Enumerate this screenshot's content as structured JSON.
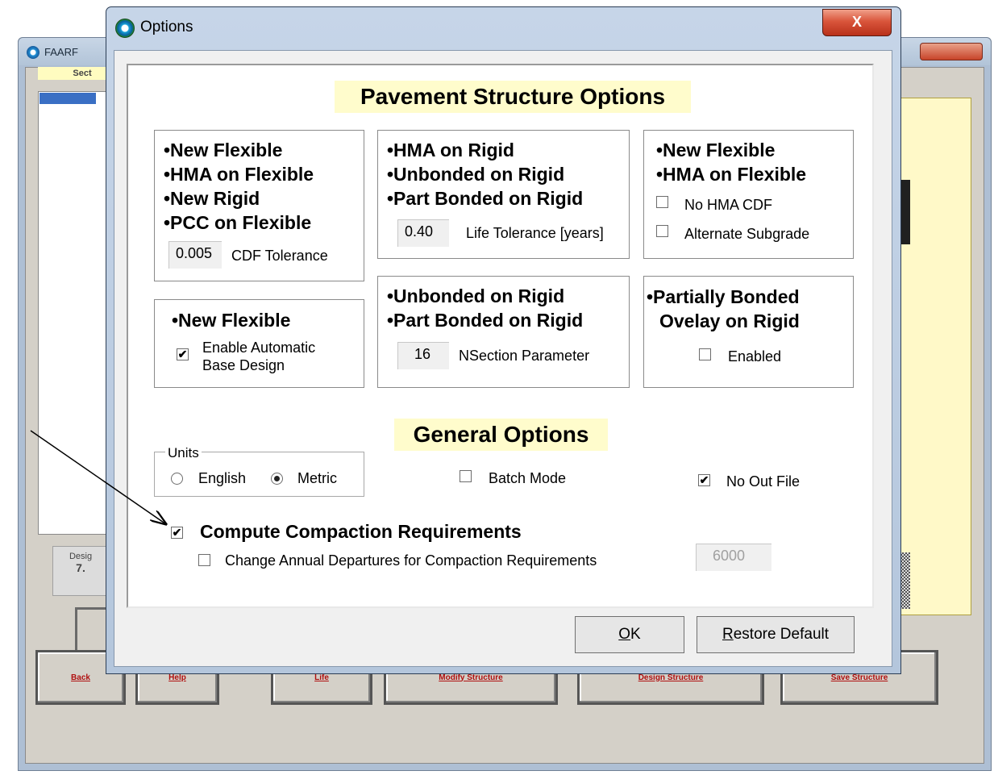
{
  "background_window": {
    "title": "FAARF",
    "section_header": "Sect",
    "design_label": "Desig",
    "design_value": "7.",
    "buttons": [
      {
        "label": "Back"
      },
      {
        "label": "Help"
      },
      {
        "label": "Life"
      },
      {
        "label": "Modify Structure"
      },
      {
        "label": "Design Structure"
      },
      {
        "label": "Save Structure"
      }
    ]
  },
  "dialog": {
    "title": "Options",
    "close_glyph": "X",
    "pavement_header": "Pavement Structure Options",
    "box1": {
      "lines": [
        "•New Flexible",
        "•HMA on Flexible",
        "•New Rigid",
        "•PCC on Flexible"
      ],
      "field_value": "0.005",
      "field_label": "CDF Tolerance"
    },
    "box2": {
      "lines": [
        "•HMA on Rigid",
        "•Unbonded on Rigid",
        "•Part Bonded on Rigid"
      ],
      "field_value": "0.40",
      "field_label": "Life Tolerance [years]"
    },
    "box3": {
      "lines": [
        "•New Flexible",
        "•HMA on Flexible"
      ],
      "no_hma_cdf": {
        "label": "No HMA CDF",
        "checked": false
      },
      "alternate_subgrade": {
        "label": "Alternate Subgrade",
        "checked": false
      }
    },
    "box4": {
      "line": "•New Flexible",
      "auto_base": {
        "label_line1": "Enable Automatic",
        "label_line2": "Base Design",
        "checked": true
      }
    },
    "box5": {
      "lines": [
        "•Unbonded on Rigid",
        "•Part Bonded on Rigid"
      ],
      "field_value": "16",
      "field_label": "NSection Parameter"
    },
    "box6": {
      "lines": [
        "•Partially  Bonded",
        "Ovelay on Rigid"
      ],
      "enabled": {
        "label": "Enabled",
        "checked": false
      }
    },
    "general_header": "General Options",
    "units": {
      "legend": "Units",
      "options": [
        {
          "label": "English",
          "selected": false
        },
        {
          "label": "Metric",
          "selected": true
        }
      ]
    },
    "batch_mode": {
      "label": "Batch Mode",
      "checked": false
    },
    "no_out_file": {
      "label": "No Out File",
      "checked": true
    },
    "compute_compaction": {
      "label": "Compute Compaction Requirements",
      "checked": true
    },
    "change_departures": {
      "label": "Change Annual Departures for Compaction Requirements",
      "checked": false
    },
    "departures_value": "6000",
    "ok_button": {
      "mnemonic": "O",
      "rest": "K"
    },
    "restore_button": {
      "mnemonic": "R",
      "rest": "estore Default"
    }
  },
  "colors": {
    "header_bg": "#fffccc",
    "arrow": "#000000"
  }
}
